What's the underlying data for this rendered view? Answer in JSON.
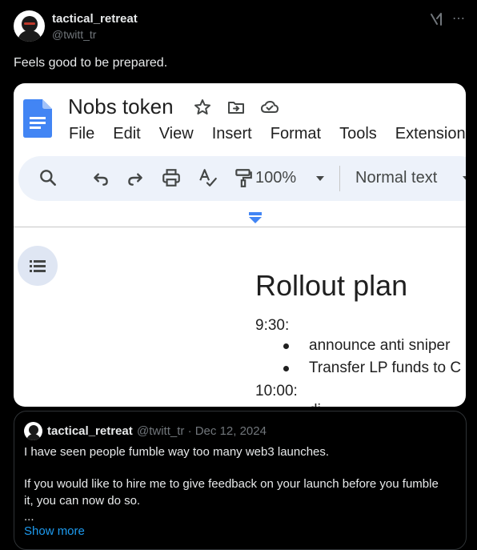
{
  "post": {
    "author_name": "tactical_retreat",
    "author_handle": "@twitt_tr",
    "text": "Feels good to be prepared."
  },
  "icons": {
    "grok": "grok-icon",
    "more": "more-icon"
  },
  "doc": {
    "title": "Nobs token",
    "menu": [
      "File",
      "Edit",
      "View",
      "Insert",
      "Format",
      "Tools",
      "Extensions"
    ],
    "zoom": "100%",
    "text_style": "Normal text",
    "heading": "Rollout plan",
    "time1": "9:30:",
    "bullet1": "announce anti sniper",
    "bullet2": "Transfer LP funds to C",
    "time2": "10:00:",
    "cut_line": "di"
  },
  "quote": {
    "author_name": "tactical_retreat",
    "meta": "@twitt_tr · Dec 12, 2024",
    "line1": "I have seen people fumble way too many web3 launches.",
    "line2": "If you would like to hire me to give feedback on your launch before you fumble",
    "line3": "it, you can now do so.",
    "line4": "...",
    "show_more": "Show more"
  },
  "colors": {
    "background": "#000000",
    "link": "#1d9bf0",
    "docs_blue": "#4285f4",
    "toolbar_bg": "#edf2fa"
  }
}
